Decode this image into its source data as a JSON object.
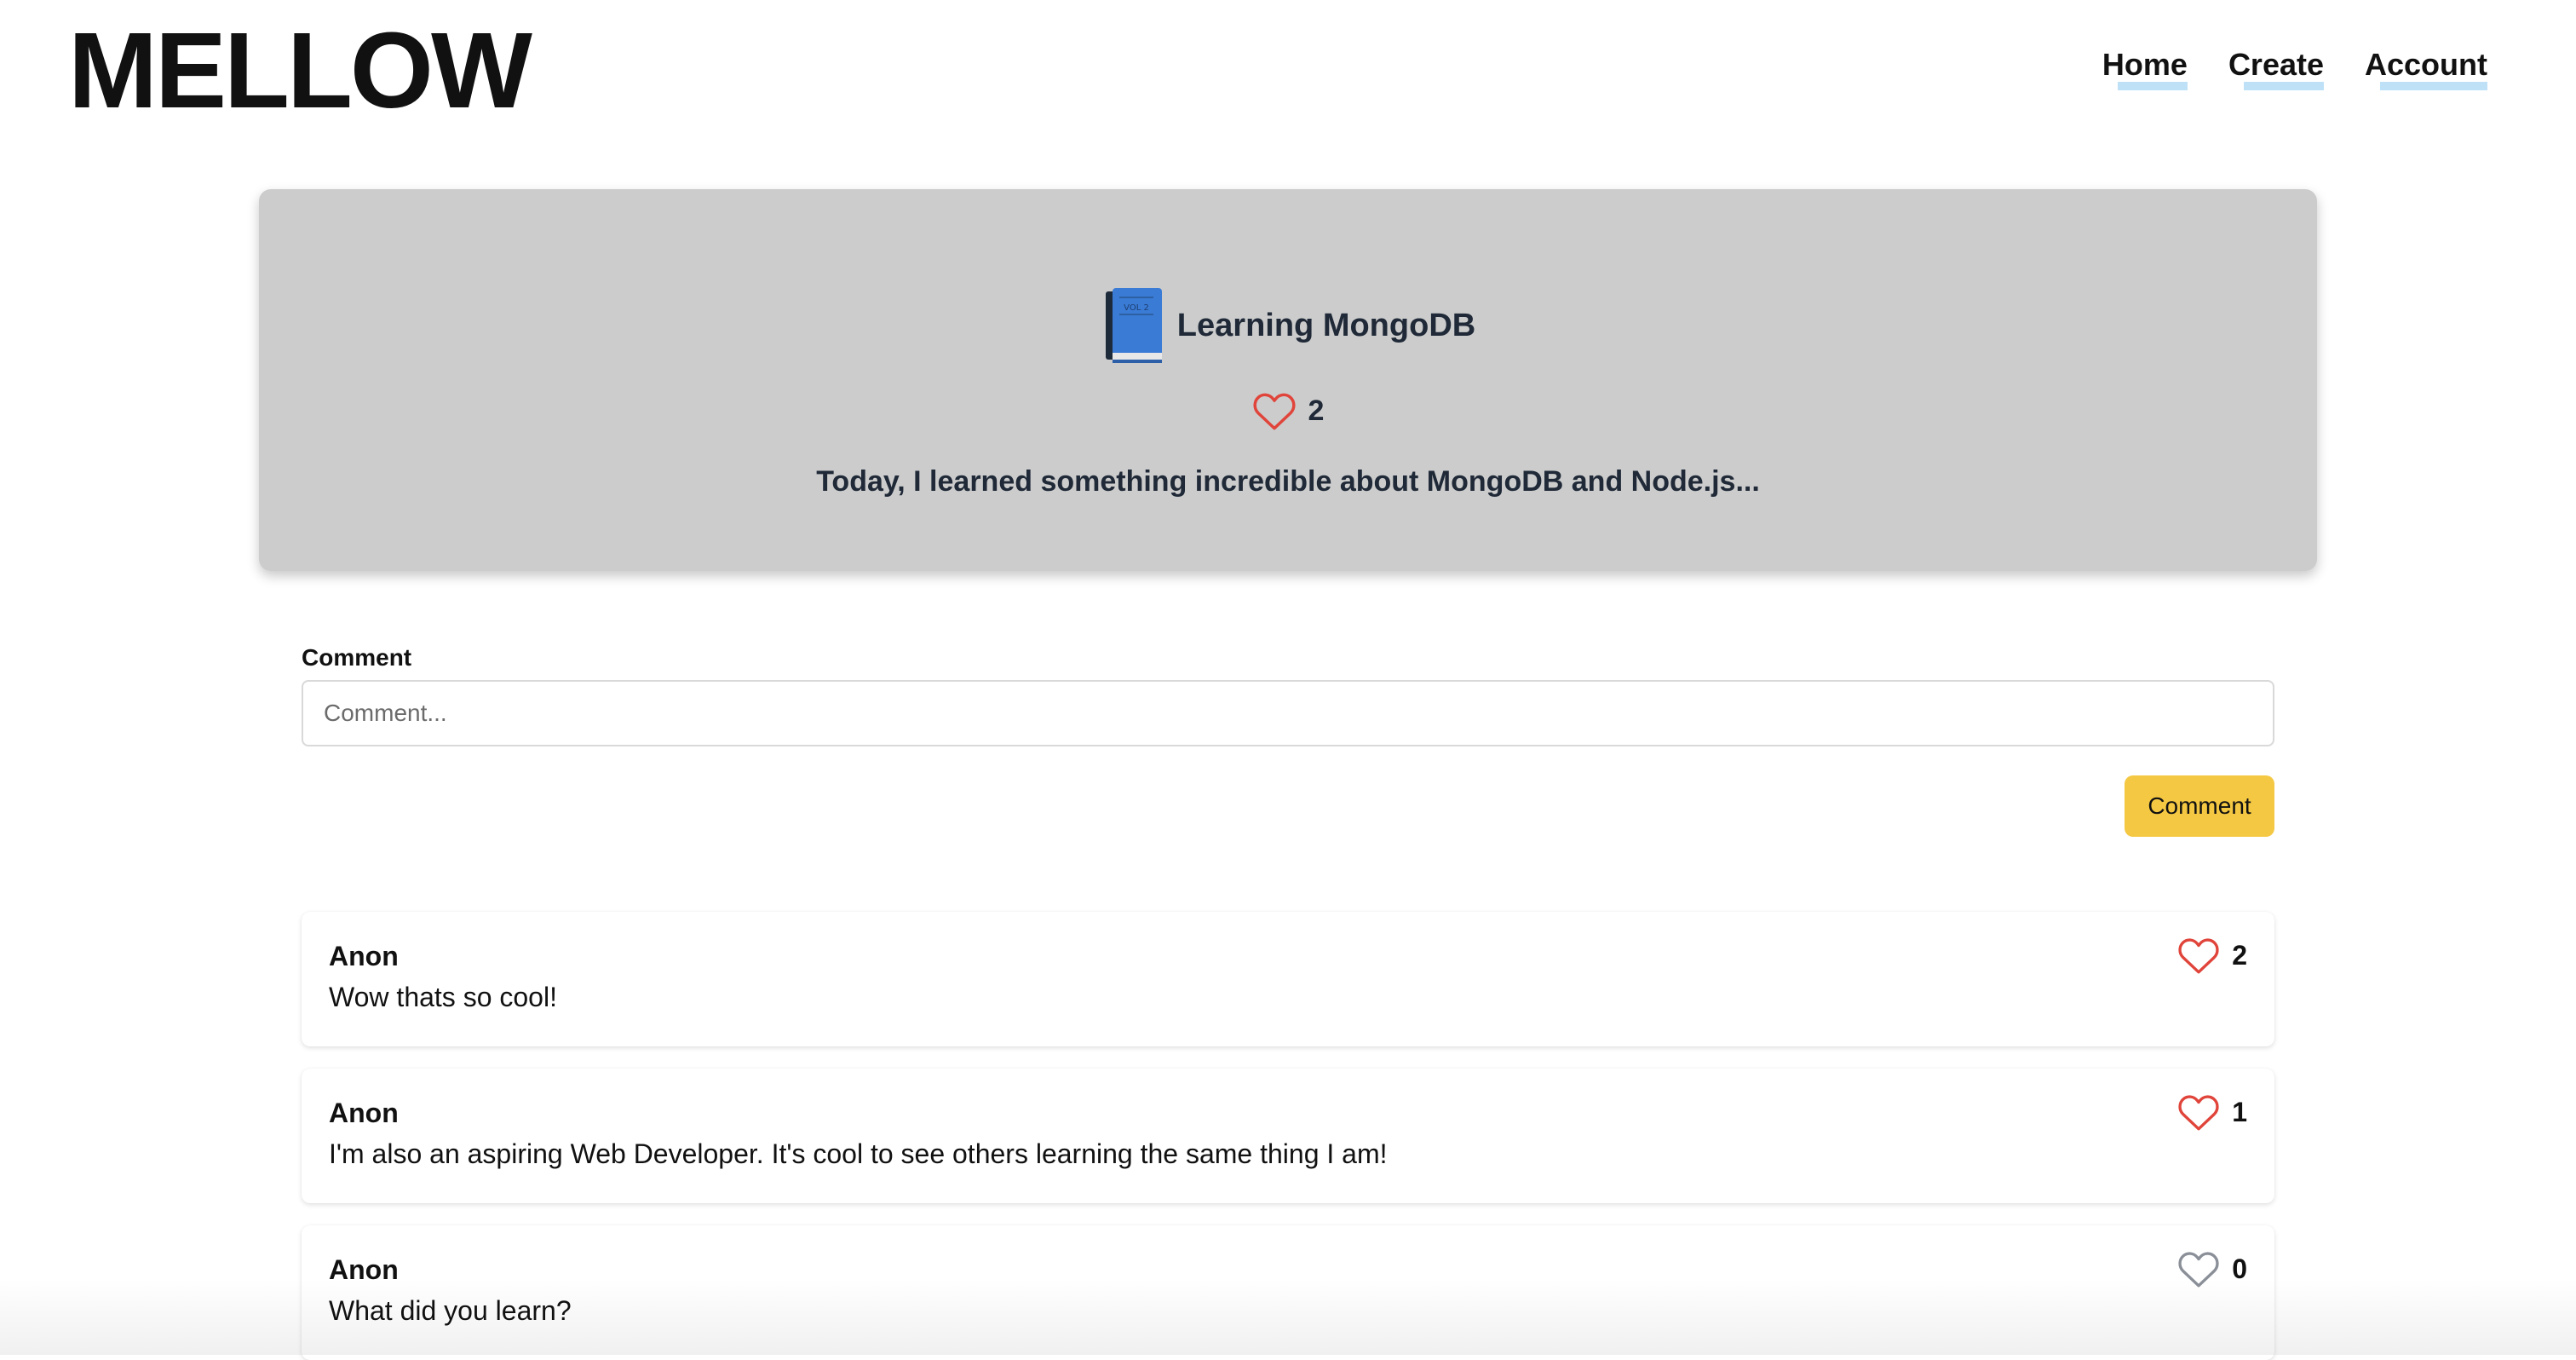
{
  "header": {
    "logo": "MELLOW",
    "nav": [
      {
        "label": "Home"
      },
      {
        "label": "Create"
      },
      {
        "label": "Account"
      }
    ]
  },
  "post": {
    "icon": "book-vol-icon",
    "icon_label": "VOL 2",
    "title": "Learning MongoDB",
    "likes": "2",
    "body": "Today, I learned something incredible about MongoDB and Node.js..."
  },
  "comment_form": {
    "label": "Comment",
    "placeholder": "Comment...",
    "value": "",
    "button_label": "Comment"
  },
  "comments": [
    {
      "author": "Anon",
      "text": "Wow thats so cool!",
      "likes": "2",
      "liked": true
    },
    {
      "author": "Anon",
      "text": "I'm also an aspiring Web Developer. It's cool to see others learning the same thing I am!",
      "likes": "1",
      "liked": true
    },
    {
      "author": "Anon",
      "text": "What did you learn?",
      "likes": "0",
      "liked": false
    }
  ],
  "colors": {
    "heart_active": "#e0443a",
    "heart_inactive": "#8a8f98",
    "accent_button": "#f4c842",
    "card_background": "#cccccc",
    "nav_underline": "#bfe1f7"
  }
}
